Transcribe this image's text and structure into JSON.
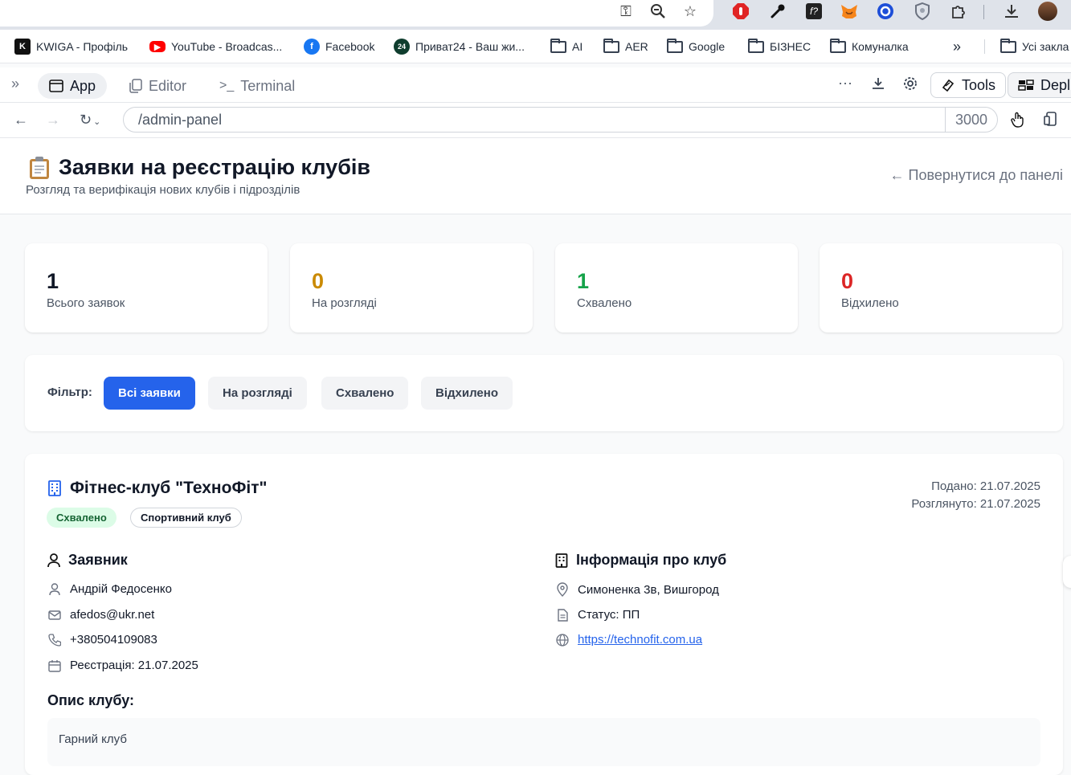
{
  "bookmarks": [
    {
      "label": "KWIGA - Профіль",
      "icon": "kwiga-icon"
    },
    {
      "label": "YouTube - Broadcas...",
      "icon": "youtube-icon"
    },
    {
      "label": "Facebook",
      "icon": "facebook-icon"
    },
    {
      "label": "Приват24 - Ваш жи...",
      "icon": "privat24-icon"
    },
    {
      "label": "AI",
      "icon": "folder-icon"
    },
    {
      "label": "AER",
      "icon": "folder-icon"
    },
    {
      "label": "Google",
      "icon": "folder-icon"
    },
    {
      "label": "БІЗНЕС",
      "icon": "folder-icon"
    },
    {
      "label": "Комуналка",
      "icon": "folder-icon"
    },
    {
      "label": "Усі закла",
      "icon": "folder-icon"
    }
  ],
  "devbar": {
    "tabs": [
      "App",
      "Editor",
      "Terminal"
    ],
    "tools_label": "Tools",
    "deploy_label": "Depl"
  },
  "urlbar": {
    "path": "/admin-panel",
    "port": "3000"
  },
  "header": {
    "title": "Заявки на реєстрацію клубів",
    "subtitle": "Розгляд та верифікація нових клубів і підрозділів",
    "back_link": "← Повернутися до панелі"
  },
  "stats": [
    {
      "value": "1",
      "label": "Всього заявок",
      "color": "#111827"
    },
    {
      "value": "0",
      "label": "На розгляді",
      "color": "#ca8a04"
    },
    {
      "value": "1",
      "label": "Схвалено",
      "color": "#16a34a"
    },
    {
      "value": "0",
      "label": "Відхилено",
      "color": "#dc2626"
    }
  ],
  "filter": {
    "label": "Фільтр:",
    "options": [
      "Всі заявки",
      "На розгляді",
      "Схвалено",
      "Відхилено"
    ],
    "active": "Всі заявки"
  },
  "club": {
    "name": "Фітнес-клуб \"ТехноФіт\"",
    "status_badge": "Схвалено",
    "type_badge": "Спортивний клуб",
    "submitted": "Подано: 21.07.2025",
    "reviewed": "Розглянуто: 21.07.2025",
    "applicant": {
      "title": "Заявник",
      "name": "Андрій Федосенко",
      "email": "afedos@ukr.net",
      "phone": "+380504109083",
      "registration": "Реєстрація: 21.07.2025"
    },
    "info": {
      "title": "Інформація про клуб",
      "address": "Симоненка 3в, Вишгород",
      "status": "Статус: ПП",
      "website": "https://technofit.com.ua"
    },
    "description_title": "Опис клубу:",
    "description": "Гарний клуб"
  },
  "colors": {
    "primary": "#2563eb",
    "approved_bg": "#dcfce7"
  }
}
